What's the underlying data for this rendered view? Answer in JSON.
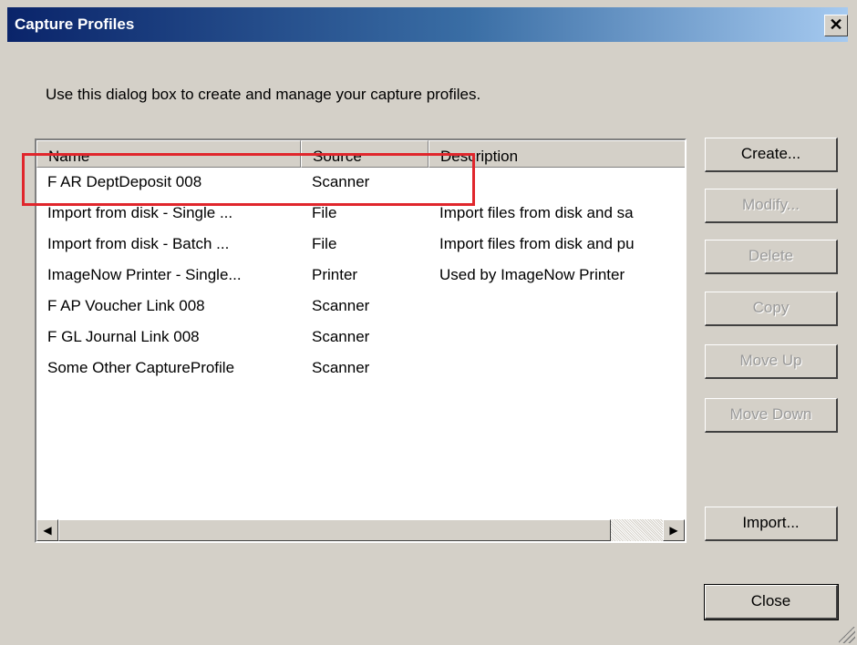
{
  "window": {
    "title": "Capture Profiles",
    "close_glyph": "✕"
  },
  "intro": "Use this dialog box to create and manage your capture profiles.",
  "list": {
    "columns": [
      "Name",
      "Source",
      "Description"
    ],
    "rows": [
      {
        "name": "F AR DeptDeposit 008",
        "source": "Scanner",
        "description": ""
      },
      {
        "name": "Import from disk - Single ...",
        "source": "File",
        "description": "Import files from disk and sa"
      },
      {
        "name": "Import from disk - Batch ...",
        "source": "File",
        "description": "Import files from disk and pu"
      },
      {
        "name": "ImageNow Printer - Single...",
        "source": "Printer",
        "description": "Used by ImageNow Printer"
      },
      {
        "name": "F AP Voucher Link 008",
        "source": "Scanner",
        "description": ""
      },
      {
        "name": "F GL Journal Link 008",
        "source": "Scanner",
        "description": ""
      },
      {
        "name": "Some Other CaptureProfile",
        "source": "Scanner",
        "description": ""
      }
    ],
    "scroll": {
      "left_glyph": "◀",
      "right_glyph": "▶"
    }
  },
  "buttons": {
    "create": "Create...",
    "modify": "Modify...",
    "delete": "Delete",
    "copy": "Copy",
    "move_up": "Move Up",
    "move_down": "Move Down",
    "import": "Import...",
    "close": "Close"
  },
  "colors": {
    "highlight": "#e0262c",
    "title_start": "#0a246a",
    "title_end": "#a6caf0",
    "face": "#d4d0c8"
  }
}
